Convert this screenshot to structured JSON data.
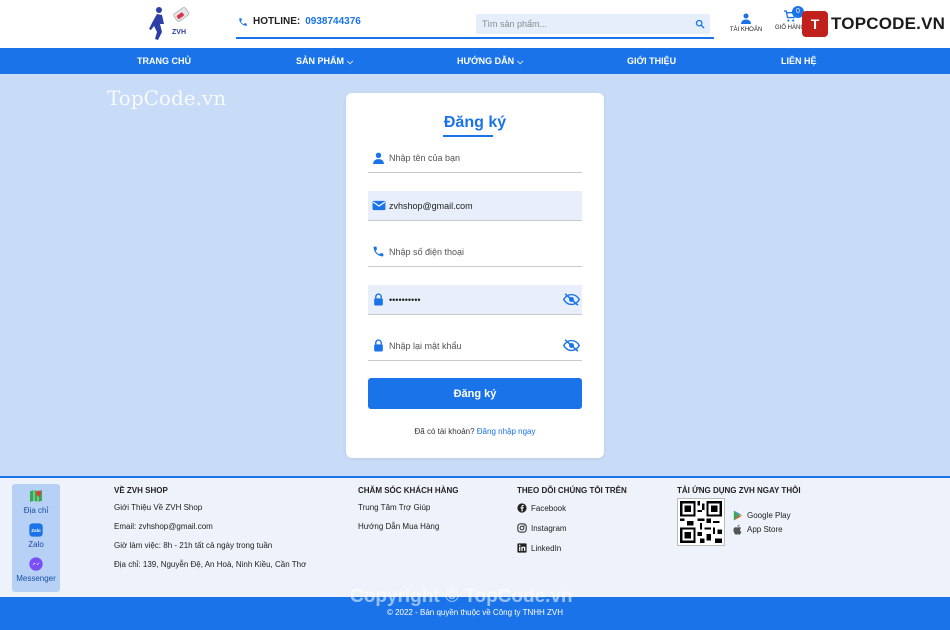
{
  "header": {
    "logo_text": "ZVH",
    "hotline_label": "HOTLINE:",
    "hotline_number": "0938744376",
    "search_placeholder": "Tìm sản phẩm...",
    "account_label": "TÀI KHOẢN",
    "cart_label": "GIỎ HÀNG",
    "cart_count": "0",
    "brand_mark": "T",
    "brand_text": "TOPCODE.VN"
  },
  "nav": {
    "items": [
      {
        "label": "TRANG CHỦ",
        "dropdown": false
      },
      {
        "label": "SẢN PHẨM",
        "dropdown": true
      },
      {
        "label": "HƯỚNG DẪN",
        "dropdown": true
      },
      {
        "label": "GIỚI THIỆU",
        "dropdown": false
      },
      {
        "label": "LIÊN HỆ",
        "dropdown": false
      }
    ]
  },
  "watermark": {
    "top": "TopCode.vn",
    "bottom": "Copyright © TopCode.vn"
  },
  "form": {
    "title": "Đăng ký",
    "name_placeholder": "Nhập tên của bạn",
    "email_value": "zvhshop@gmail.com",
    "phone_placeholder": "Nhập số điện thoại",
    "password_value": "••••••••••",
    "confirm_placeholder": "Nhập lại mật khẩu",
    "submit_label": "Đăng ký",
    "have_account_text": "Đã có tài khoản?",
    "login_link": "Đăng nhập ngay"
  },
  "float_contacts": [
    {
      "label": "Địa chỉ",
      "icon": "map-icon"
    },
    {
      "label": "Zalo",
      "icon": "zalo-icon"
    },
    {
      "label": "Messenger",
      "icon": "messenger-icon"
    }
  ],
  "footer": {
    "about": {
      "heading": "VỀ ZVH SHOP",
      "items": [
        "Giới Thiệu Về ZVH Shop",
        "Email: zvhshop@gmail.com",
        "Giờ làm việc: 8h - 21h tất cả ngày trong tuần",
        "Địa chỉ: 139, Nguyễn Đệ, An Hoà, Ninh Kiều, Cần Thơ"
      ]
    },
    "care": {
      "heading": "CHĂM SÓC KHÁCH HÀNG",
      "items": [
        "Trung Tâm Trợ Giúp",
        "Hướng Dẫn Mua Hàng"
      ]
    },
    "follow": {
      "heading": "THEO DÕI CHÚNG TÔI TRÊN",
      "items": [
        "Facebook",
        "Instagram",
        "LinkedIn"
      ]
    },
    "app": {
      "heading": "TẢI ỨNG DỤNG ZVH NGAY THÔI",
      "google_play": "Google Play",
      "app_store": "App Store"
    },
    "copyright": "© 2022 - Bản quyền thuộc về Công ty TNHH ZVH"
  },
  "colors": {
    "primary": "#1a73e8",
    "page_bg": "#c9dcf7",
    "brand_red": "#c0211c"
  }
}
